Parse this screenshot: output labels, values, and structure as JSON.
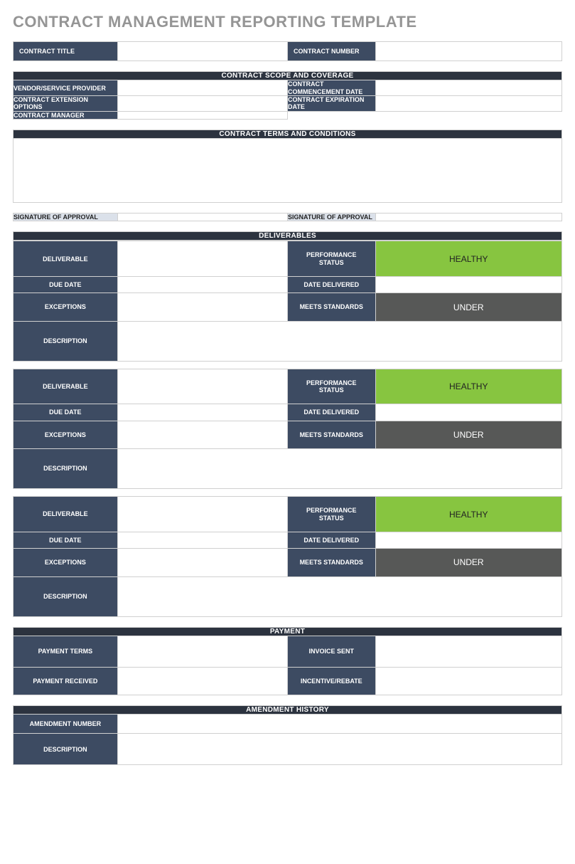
{
  "title": "CONTRACT MANAGEMENT REPORTING TEMPLATE",
  "top": {
    "contract_title_label": "CONTRACT TITLE",
    "contract_title_value": "",
    "contract_number_label": "CONTRACT NUMBER",
    "contract_number_value": ""
  },
  "scope": {
    "header": "CONTRACT SCOPE AND COVERAGE",
    "vendor_label": "VENDOR/SERVICE PROVIDER",
    "vendor_value": "",
    "commencement_label": "CONTRACT COMMENCEMENT DATE",
    "commencement_value": "",
    "extension_label": "CONTRACT EXTENSION OPTIONS",
    "extension_value": "",
    "expiration_label": "CONTRACT EXPIRATION DATE",
    "expiration_value": "",
    "manager_label": "CONTRACT MANAGER",
    "manager_value": ""
  },
  "terms": {
    "header": "CONTRACT TERMS AND CONDITIONS",
    "body": "",
    "sig1_label": "SIGNATURE OF APPROVAL",
    "sig1_value": "",
    "sig2_label": "SIGNATURE OF APPROVAL",
    "sig2_value": ""
  },
  "deliverables_header": "DELIVERABLES",
  "del_labels": {
    "deliverable": "DELIVERABLE",
    "perf_status": "PERFORMANCE STATUS",
    "due_date": "DUE DATE",
    "date_delivered": "DATE DELIVERED",
    "exceptions": "EXCEPTIONS",
    "meets_std": "MEETS STANDARDS",
    "description": "DESCRIPTION"
  },
  "deliverables": [
    {
      "deliverable": "",
      "perf_status": "HEALTHY",
      "due_date": "",
      "date_delivered": "",
      "exceptions": "",
      "meets_std": "UNDER",
      "description": ""
    },
    {
      "deliverable": "",
      "perf_status": "HEALTHY",
      "due_date": "",
      "date_delivered": "",
      "exceptions": "",
      "meets_std": "UNDER",
      "description": ""
    },
    {
      "deliverable": "",
      "perf_status": "HEALTHY",
      "due_date": "",
      "date_delivered": "",
      "exceptions": "",
      "meets_std": "UNDER",
      "description": ""
    }
  ],
  "payment": {
    "header": "PAYMENT",
    "terms_label": "PAYMENT TERMS",
    "terms_value": "",
    "invoice_label": "INVOICE SENT",
    "invoice_value": "",
    "received_label": "PAYMENT RECEIVED",
    "received_value": "",
    "incentive_label": "INCENTIVE/REBATE",
    "incentive_value": ""
  },
  "amendment": {
    "header": "AMENDMENT HISTORY",
    "number_label": "AMENDMENT NUMBER",
    "number_value": "",
    "desc_label": "DESCRIPTION",
    "desc_value": ""
  }
}
